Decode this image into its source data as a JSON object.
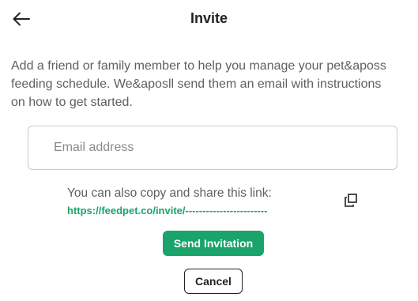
{
  "header": {
    "title": "Invite",
    "back_icon": "arrow-left-icon"
  },
  "description_lines": [
    "Add a friend or family member to help you manage your pet&aposs",
    "feeding schedule. We&aposll send them an email with instructions",
    "on how to get started."
  ],
  "email": {
    "placeholder": "Email address",
    "value": ""
  },
  "share": {
    "text": "You can also copy and share this link:",
    "link": "https://feedpet.co/invite/------------------------",
    "copy_icon": "copy-icon"
  },
  "actions": {
    "send_label": "Send Invitation",
    "cancel_label": "Cancel"
  },
  "colors": {
    "accent": "#1aa36b",
    "text": "#212121",
    "muted": "#5f5f5f"
  }
}
